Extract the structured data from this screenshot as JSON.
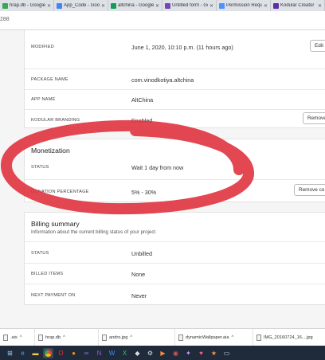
{
  "browser": {
    "tabs": [
      {
        "label": "hrap.db - Google D",
        "color": "#34a853"
      },
      {
        "label": "App_Code - Googl",
        "color": "#4285f4"
      },
      {
        "label": "altchina - Google S",
        "color": "#0f9d58"
      },
      {
        "label": "Untitled form - Go",
        "color": "#7248b9"
      },
      {
        "label": "Permission Requir",
        "color": "#4d90fe"
      },
      {
        "label": "Kodular Creator",
        "color": "#5b2ea6"
      }
    ],
    "url_fragment": "288"
  },
  "app_info": {
    "modified": {
      "label": "MODIFIED",
      "value": "June 1, 2020, 10:10 p.m. (11 hours ago)",
      "button": "Edit i"
    },
    "package_name": {
      "label": "PACKAGE NAME",
      "value": "com.vinodkotiya.altchina"
    },
    "app_name": {
      "label": "APP NAME",
      "value": "AltChina"
    },
    "kodular_branding": {
      "label": "KODULAR BRANDING",
      "value": "Enabled",
      "button": "Remove"
    }
  },
  "monetization": {
    "title": "Monetization",
    "status": {
      "label": "STATUS",
      "value": "Wait 1 day from now"
    },
    "percentage": {
      "label": "DONATION PERCENTAGE",
      "value": "5% - 30%",
      "button": "Remove co"
    }
  },
  "billing": {
    "title": "Billing summary",
    "subtitle": "Information about the current billing status of your project",
    "status": {
      "label": "STATUS",
      "value": "Unbilled"
    },
    "billed_items": {
      "label": "BILLED ITEMS",
      "value": "None"
    },
    "next_payment": {
      "label": "NEXT PAYMENT ON",
      "value": "Never"
    }
  },
  "downloads": [
    {
      "name": ".aix"
    },
    {
      "name": "hrap.db"
    },
    {
      "name": "andro.jpg"
    },
    {
      "name": "dynamicWallpaper.aia"
    },
    {
      "name": "IMG_20160724_16....jpg"
    }
  ],
  "annotation": {
    "color": "#e0333f"
  }
}
